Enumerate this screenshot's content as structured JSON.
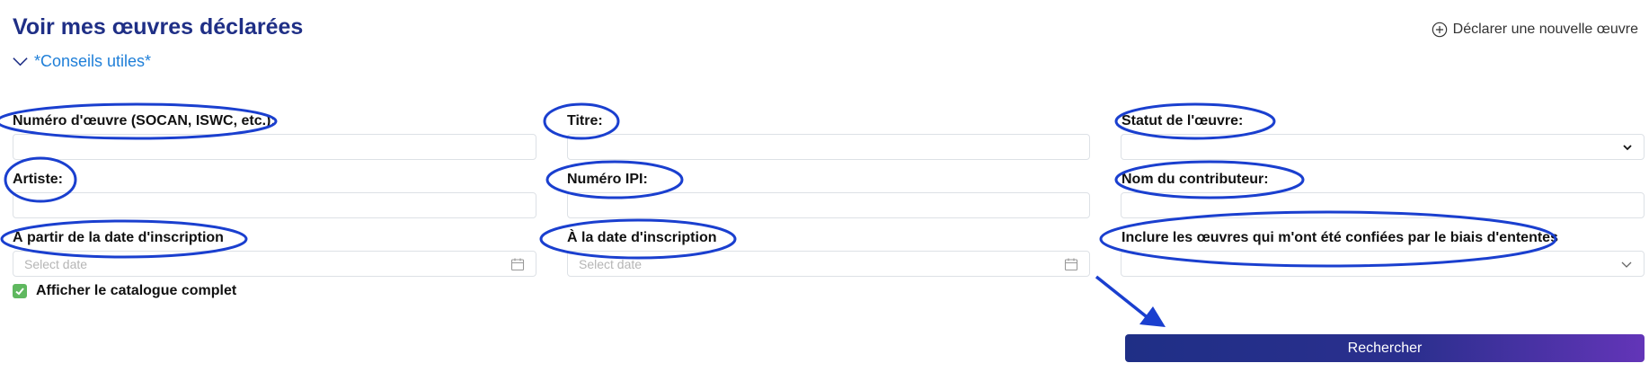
{
  "page": {
    "title": "Voir mes œuvres déclarées"
  },
  "header": {
    "tips_label": "*Conseils utiles*",
    "declare_label": "Déclarer une nouvelle œuvre"
  },
  "form": {
    "work_number_label": "Numéro d'œuvre (SOCAN, ISWC, etc.):",
    "title_label": "Titre:",
    "status_label": "Statut de l'œuvre:",
    "artist_label": "Artiste:",
    "ipi_label": "Numéro IPI:",
    "contributor_label": "Nom du contributeur:",
    "from_date_label": "À partir de la date d'inscription",
    "from_date_placeholder": "Select date",
    "to_date_label": "À la date d'inscription",
    "to_date_placeholder": "Select date",
    "include_label": "Inclure les œuvres qui m'ont été confiées par le biais d'ententes",
    "catalog_label": "Afficher le catalogue complet",
    "catalog_checked": true,
    "search_label": "Rechercher"
  },
  "colors": {
    "title": "#1f2f86",
    "link": "#1f7fd8",
    "annotation": "#1a3fcf",
    "checkbox": "#5fb85f",
    "button_start": "#1f2f86",
    "button_end": "#6335b8"
  },
  "icons": {
    "tips": "chevron-down-icon",
    "declare": "plus-circle-icon",
    "date": "calendar-icon",
    "select": "chevron-down-icon",
    "checkbox": "check-icon"
  }
}
